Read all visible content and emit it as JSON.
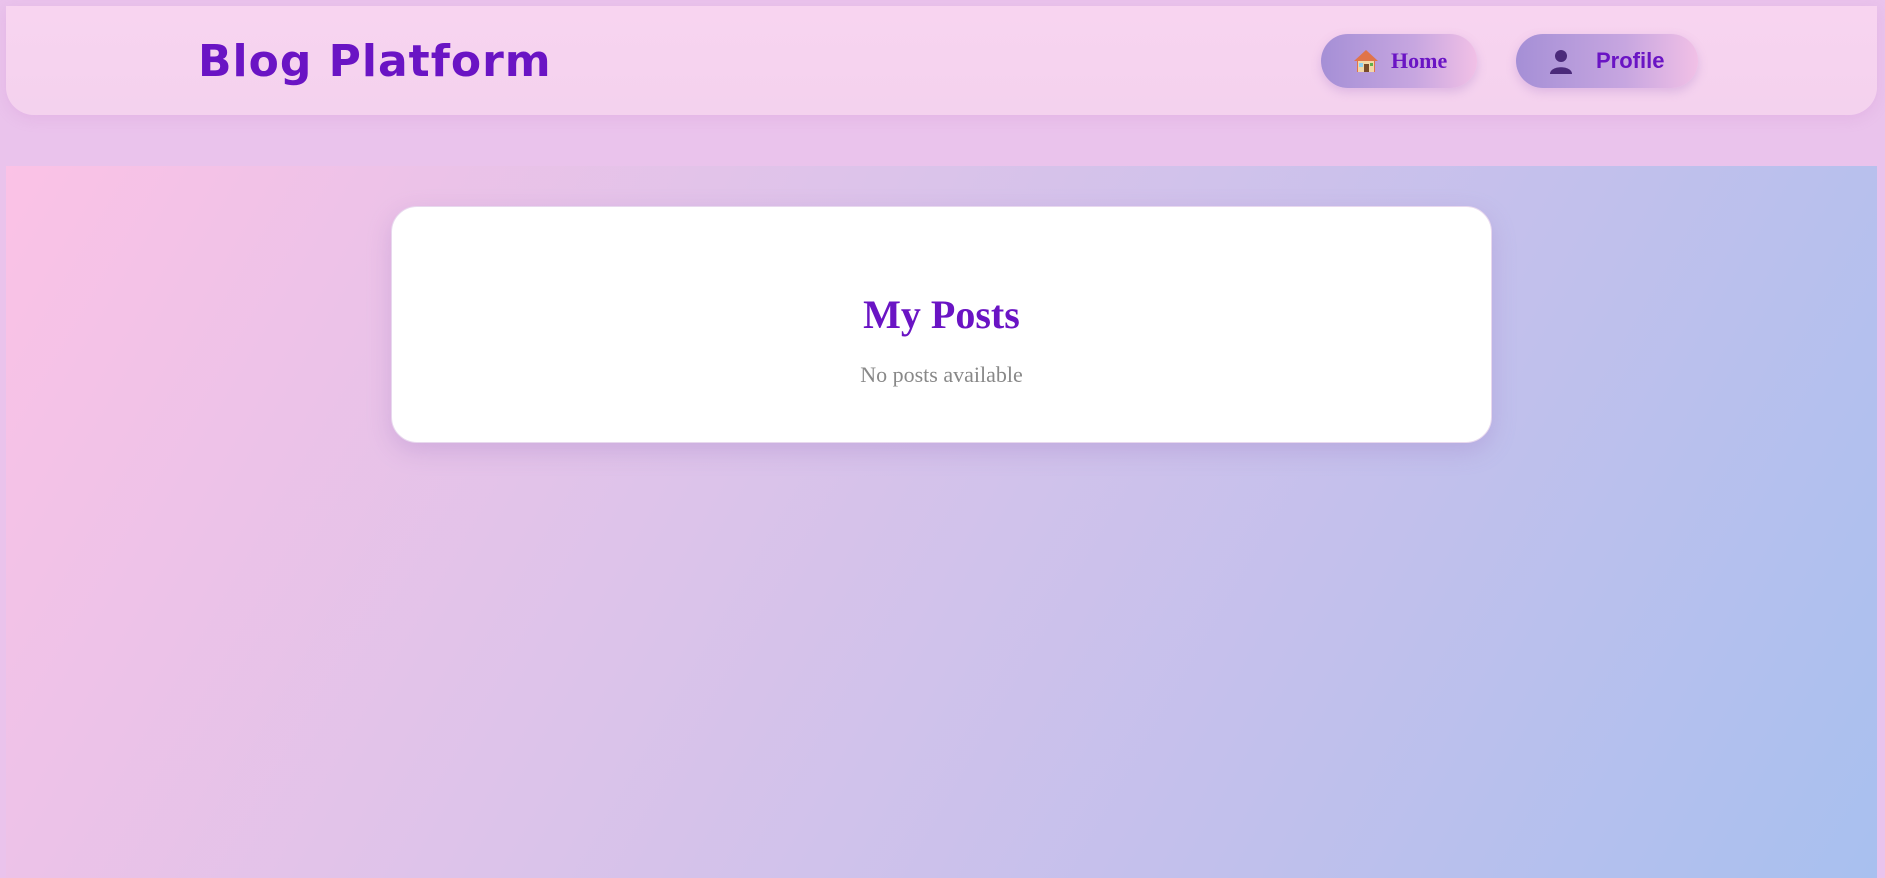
{
  "header": {
    "brand": "Blog Platform",
    "nav": [
      {
        "label": "Home",
        "icon": "house-icon"
      },
      {
        "label": "Profile",
        "icon": "user-icon"
      }
    ]
  },
  "main": {
    "title": "My Posts",
    "empty_message": "No posts available"
  },
  "colors": {
    "accent": "#6a14c4",
    "muted_text": "#888888"
  }
}
